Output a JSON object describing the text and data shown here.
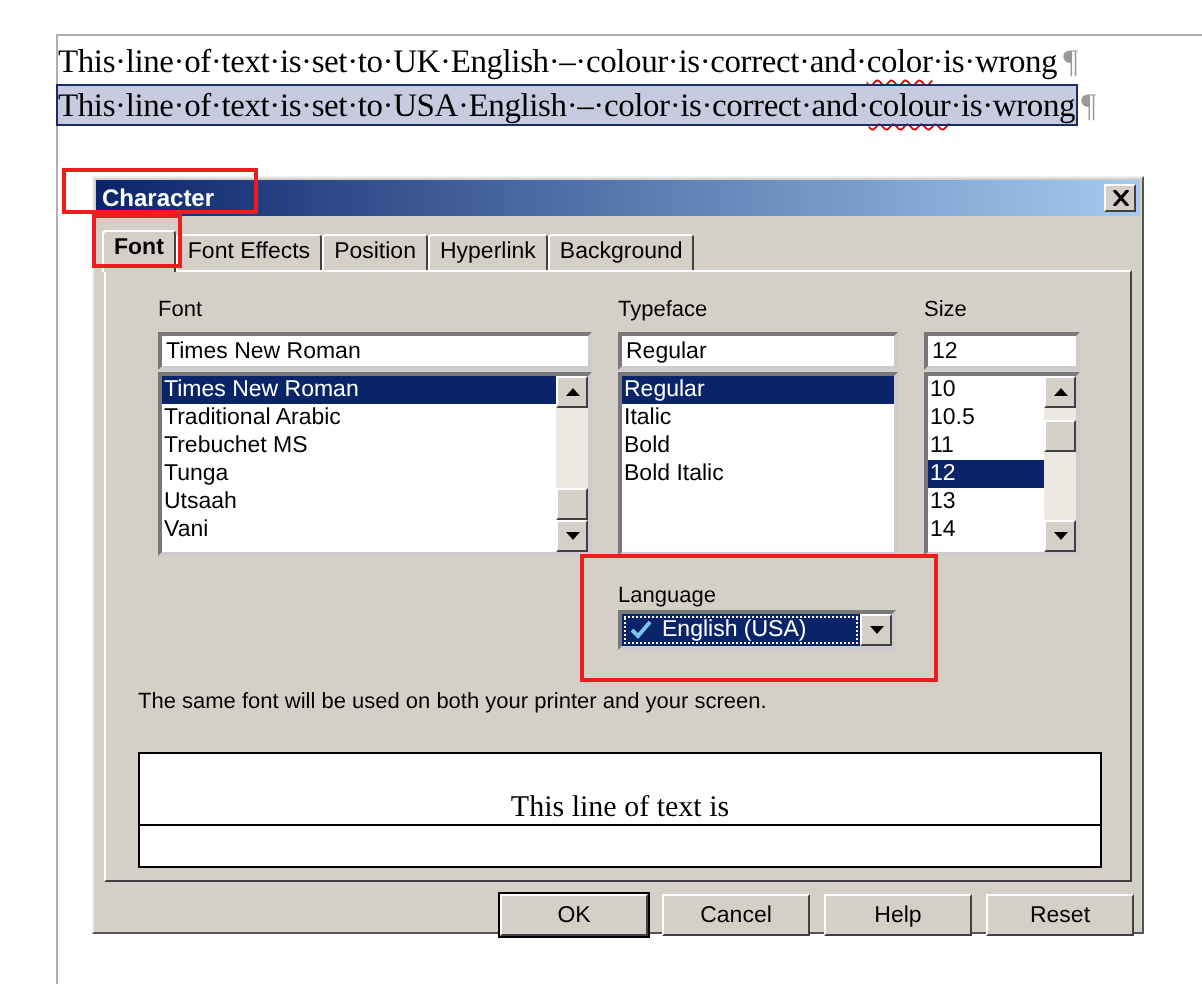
{
  "document": {
    "lines": [
      {
        "selected": false,
        "segments": [
          {
            "text": "This·line·of·text·is·set·to·UK·English·–·colour·is·correct·and·",
            "misspelled": false
          },
          {
            "text": "color",
            "misspelled": true
          },
          {
            "text": "·is·wrong",
            "misspelled": false
          }
        ],
        "mark": "¶"
      },
      {
        "selected": true,
        "segments": [
          {
            "text": "This·line·of·text·is·set·to·USA·English·–·color·is·correct·and·",
            "misspelled": false
          },
          {
            "text": "colour",
            "misspelled": true
          },
          {
            "text": "·is·wrong",
            "misspelled": false
          }
        ],
        "mark": "¶"
      }
    ]
  },
  "dialog": {
    "title": "Character",
    "tabs": [
      {
        "label": "Font",
        "selected": true
      },
      {
        "label": "Font Effects",
        "selected": false
      },
      {
        "label": "Position",
        "selected": false
      },
      {
        "label": "Hyperlink",
        "selected": false
      },
      {
        "label": "Background",
        "selected": false
      }
    ],
    "font": {
      "label": "Font",
      "value": "Times New Roman",
      "items": [
        {
          "label": "Times New Roman",
          "selected": true
        },
        {
          "label": "Traditional Arabic",
          "selected": false
        },
        {
          "label": "Trebuchet MS",
          "selected": false
        },
        {
          "label": "Tunga",
          "selected": false
        },
        {
          "label": "Utsaah",
          "selected": false
        },
        {
          "label": "Vani",
          "selected": false
        }
      ]
    },
    "typeface": {
      "label": "Typeface",
      "value": "Regular",
      "items": [
        {
          "label": "Regular",
          "selected": true
        },
        {
          "label": "Italic",
          "selected": false
        },
        {
          "label": "Bold",
          "selected": false
        },
        {
          "label": "Bold Italic",
          "selected": false
        }
      ]
    },
    "size": {
      "label": "Size",
      "value": "12",
      "items": [
        {
          "label": "10",
          "selected": false
        },
        {
          "label": "10.5",
          "selected": false
        },
        {
          "label": "11",
          "selected": false
        },
        {
          "label": "12",
          "selected": true
        },
        {
          "label": "13",
          "selected": false
        },
        {
          "label": "14",
          "selected": false
        }
      ]
    },
    "language": {
      "label": "Language",
      "value": "English (USA)",
      "checked": true
    },
    "note": "The same font will be used on both your printer and your screen.",
    "preview": "This line of text is",
    "buttons": [
      "OK",
      "Cancel",
      "Help",
      "Reset"
    ]
  }
}
